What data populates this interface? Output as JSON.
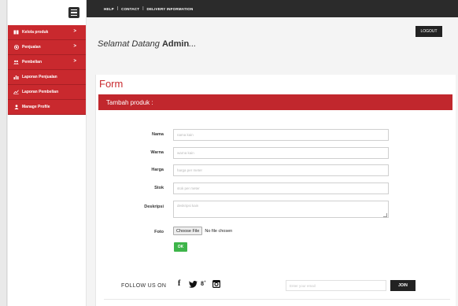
{
  "sidebar": {
    "items": [
      {
        "label": "Kelola produk",
        "icon": "book-icon",
        "chevron": ">"
      },
      {
        "label": "Penjualan",
        "icon": "globe-icon",
        "chevron": ">"
      },
      {
        "label": "Pembelian",
        "icon": "users-icon",
        "chevron": ">"
      },
      {
        "label": "Laporan Penjualan",
        "icon": "bar-chart-icon"
      },
      {
        "label": "Laporan Pembelian",
        "icon": "line-chart-icon"
      },
      {
        "label": "Manage Profile",
        "icon": "user-icon"
      }
    ]
  },
  "topbar": {
    "links": [
      "HELP",
      "CONTACT",
      "DELIVERY INFORMATION"
    ],
    "separator": "|"
  },
  "header": {
    "logout_label": "LOGOUT",
    "welcome_prefix": "Selamat Datang ",
    "welcome_user": "Admin",
    "welcome_suffix": "..."
  },
  "form": {
    "title": "Form",
    "section_title": "Tambah produk :",
    "fields": [
      {
        "label": "Nama",
        "placeholder": "nama kain"
      },
      {
        "label": "Warna",
        "placeholder": "warna kain"
      },
      {
        "label": "Harga",
        "placeholder": "harga per meter"
      },
      {
        "label": "Stok",
        "placeholder": "stok per meter"
      },
      {
        "label": "Deskripsi",
        "placeholder": "deskripsi kain"
      },
      {
        "label": "Foto",
        "button": "Choose File",
        "status": "No file chosen"
      }
    ],
    "submit_label": "OK"
  },
  "footer": {
    "follow_label": "FOLLOW US ON",
    "social": [
      {
        "name": "facebook-icon",
        "glyph": "f"
      },
      {
        "name": "twitter-icon",
        "glyph": "🐦"
      },
      {
        "name": "google-plus-icon",
        "glyph": "8+"
      },
      {
        "name": "instagram-icon",
        "glyph": "◙"
      }
    ],
    "email_placeholder": "Enter your email",
    "join_label": "JOIN"
  },
  "colors": {
    "accent": "#c9292e",
    "topbar": "#2b2b2b",
    "ok": "#3db54a"
  }
}
